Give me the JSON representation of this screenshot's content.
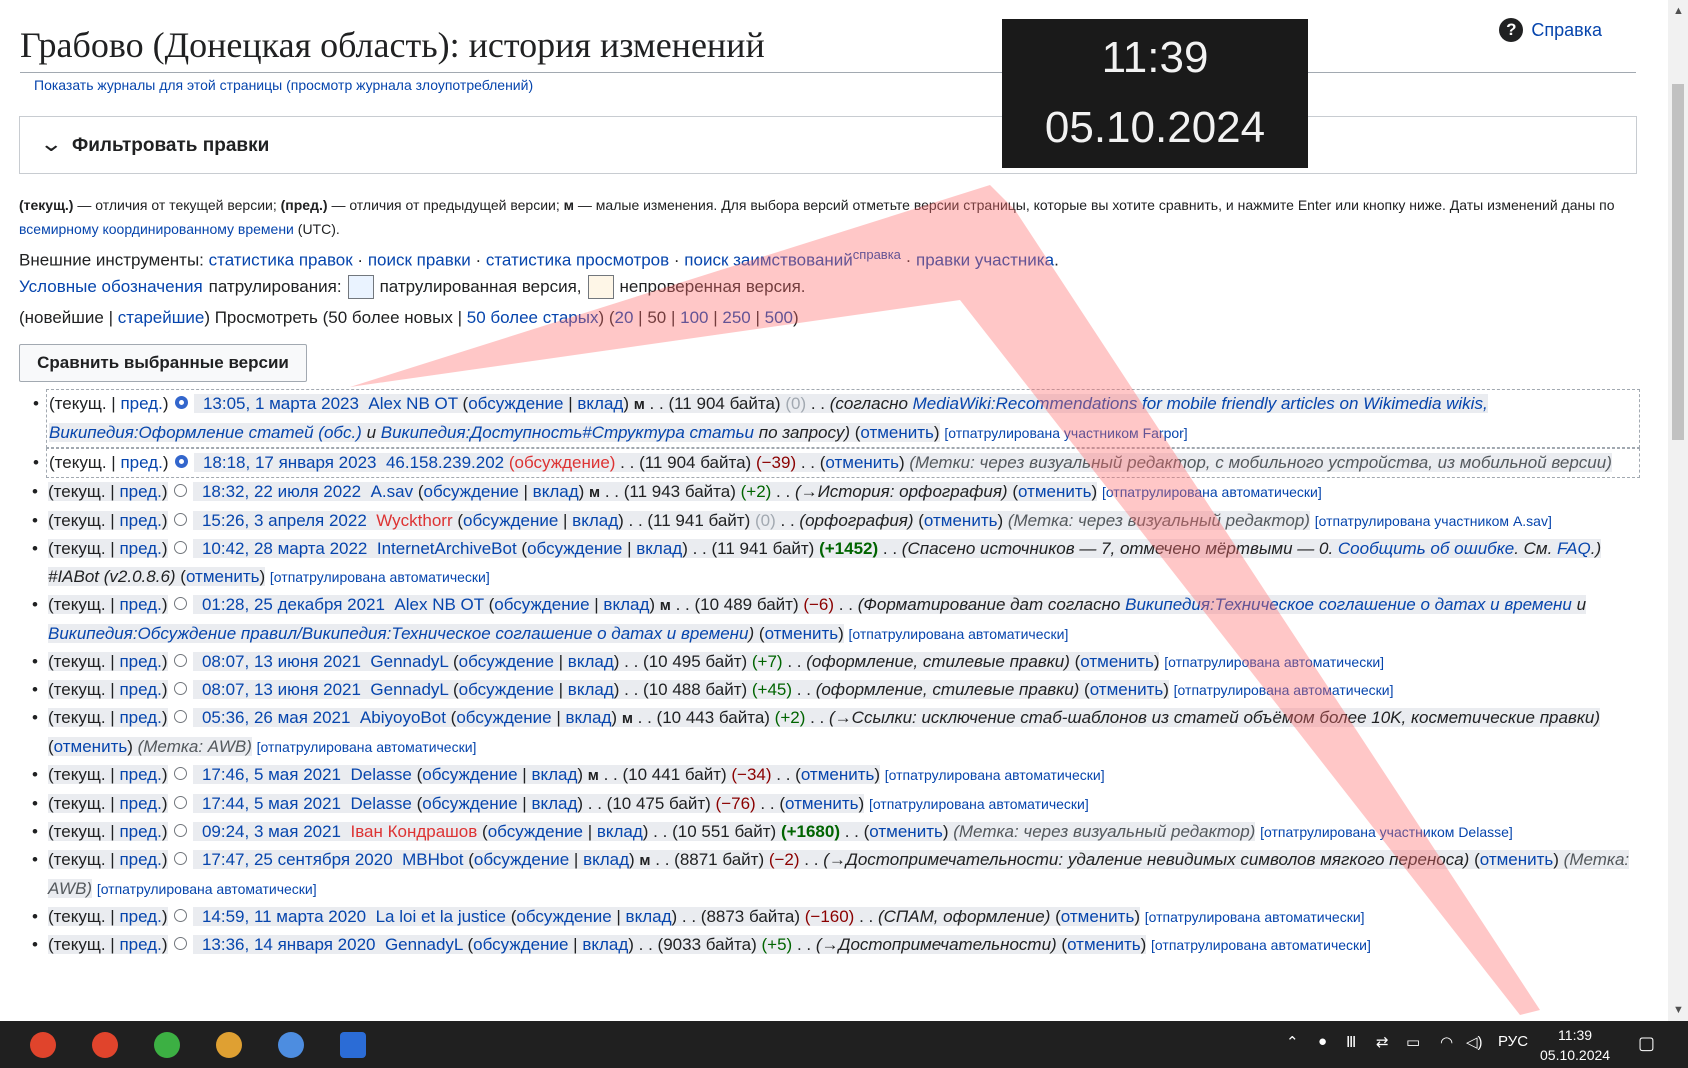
{
  "page": {
    "title": "Грабово (Донецкая область): история изменений",
    "help": "Справка",
    "logs_link": "Показать журналы для этой страницы",
    "abuse_link": "(просмотр журнала злоупотреблений)",
    "filter_label": "Фильтровать правки",
    "legend_line1": "— отличия от текущей версии;",
    "legend_cur": "(текущ.)",
    "legend_prev": "(пред.)",
    "legend_prev_text": "— отличия от предыдущей версии;",
    "legend_m": "м",
    "legend_m_text": "— малые изменения. Для выбора версий отметьте версии страницы, которые вы хотите сравнить, и нажмите Enter или кнопку ниже. Даты изменений даны по",
    "legend_utc_link": "всемирному координированному времени",
    "legend_utc": "(UTC).",
    "ext_label": "Внешние инструменты:",
    "ext_tools": [
      "статистика правок",
      "поиск правки",
      "статистика просмотров",
      "поиск заимствований"
    ],
    "ext_help": "справка",
    "ext_user": "правки участника",
    "patrol_link": "Условные обозначения",
    "patrol_label": "патрулирования:",
    "patrol_done": "патрулированная версия,",
    "patrol_not": "непроверенная версия.",
    "nav_newest": "(новейшие |",
    "nav_oldest": "старейшие",
    "nav_view": ") Просмотреть (50 более новых |",
    "nav_older": "50 более старых",
    "nav_counts": [
      "20",
      "50",
      "100",
      "250",
      "500"
    ],
    "compare_button": "Сравнить выбранные версии"
  },
  "history": [
    {
      "time": "13:05, 1 марта 2023",
      "user": "Alex NB OT",
      "minor": true,
      "size": "(11 904 байта)",
      "diff": "(0)",
      "diff_class": "neu",
      "comment_html": "(согласно <a>MediaWiki:Recommendations for mobile friendly articles on Wikimedia wikis, Википедия:Оформление статей (обс.)</a> и <a>Википедия:Доступность#Структура статьи</a> по запросу)",
      "tail": "[отпатрулирована участником Farpor]",
      "selected": true,
      "current": true
    },
    {
      "time": "18:18, 17 января 2023",
      "user": "46.158.239.202",
      "minor": false,
      "size": "(11 904 байта)",
      "diff": "(−39)",
      "diff_class": "neg",
      "comment_html": "",
      "tag": "(Метки: через визуальный редактор, с мобильного устройства, из мобильной версии)",
      "selected": true,
      "current": true,
      "anon": true
    },
    {
      "time": "18:32, 22 июля 2022",
      "user": "A.sav",
      "minor": true,
      "size": "(11 943 байта)",
      "diff": "(+2)",
      "diff_class": "pos",
      "comment_html": "(→История: орфография)",
      "tail": "[отпатрулирована автоматически]"
    },
    {
      "time": "15:26, 3 апреля 2022",
      "user": "Wyckthorr",
      "minor": false,
      "size": "(11 941 байт)",
      "diff": "(0)",
      "diff_class": "neu",
      "comment_html": "(орфография)",
      "tag": "(Метка: через визуальный редактор)",
      "tail": "[отпатрулирована участником A.sav]",
      "redUser": true
    },
    {
      "time": "10:42, 28 марта 2022",
      "user": "InternetArchiveBot",
      "minor": false,
      "size": "(11 941 байт)",
      "diff": "(+1452)",
      "diff_class": "posb",
      "comment_html": "(Спасено источников — 7, отмечено мёртвыми — 0. <a>Сообщить об ошибке</a>. См. <a>FAQ</a>.) #IABot (v2.0.8.6)",
      "tail": "[отпатрулирована автоматически]"
    },
    {
      "time": "01:28, 25 декабря 2021",
      "user": "Alex NB OT",
      "minor": true,
      "size": "(10 489 байт)",
      "diff": "(−6)",
      "diff_class": "neg",
      "comment_html": "(Форматирование дат согласно <a>Википедия:Техническое соглашение о датах и времени</a> и <a>Википедия:Обсуждение правил/Википедия:Техническое соглашение о датах и времени</a>)",
      "tail": "[отпатрулирована автоматически]"
    },
    {
      "time": "08:07, 13 июня 2021",
      "user": "GennadyL",
      "minor": false,
      "size": "(10 495 байт)",
      "diff": "(+7)",
      "diff_class": "pos",
      "comment_html": "(оформление, стилевые правки)",
      "tail": "[отпатрулирована автоматически]"
    },
    {
      "time": "08:07, 13 июня 2021",
      "user": "GennadyL",
      "minor": false,
      "size": "(10 488 байт)",
      "diff": "(+45)",
      "diff_class": "pos",
      "comment_html": "(оформление, стилевые правки)",
      "tail": "[отпатрулирована автоматически]"
    },
    {
      "time": "05:36, 26 мая 2021",
      "user": "AbiyoyoBot",
      "minor": true,
      "size": "(10 443 байта)",
      "diff": "(+2)",
      "diff_class": "pos",
      "comment_html": "(→Ссылки: исключение стаб-шаблонов из статей объёмом более 10K, косметические правки)",
      "tag": "(Метка: AWB)",
      "tail": "[отпатрулирована автоматически]"
    },
    {
      "time": "17:46, 5 мая 2021",
      "user": "Delasse",
      "minor": true,
      "size": "(10 441 байт)",
      "diff": "(−34)",
      "diff_class": "neg",
      "comment_html": "",
      "tail": "[отпатрулирована автоматически]"
    },
    {
      "time": "17:44, 5 мая 2021",
      "user": "Delasse",
      "minor": false,
      "size": "(10 475 байт)",
      "diff": "(−76)",
      "diff_class": "neg",
      "comment_html": "",
      "tail": "[отпатрулирована автоматически]"
    },
    {
      "time": "09:24, 3 мая 2021",
      "user": "Іван Кондрашов",
      "minor": false,
      "size": "(10 551 байт)",
      "diff": "(+1680)",
      "diff_class": "posb",
      "comment_html": "",
      "tag": "(Метка: через визуальный редактор)",
      "tail": "[отпатрулирована участником Delasse]",
      "redUser": true
    },
    {
      "time": "17:47, 25 сентября 2020",
      "user": "MBHbot",
      "minor": true,
      "size": "(8871 байт)",
      "diff": "(−2)",
      "diff_class": "neg",
      "comment_html": "(→Достопримечательности: удаление невидимых символов мягкого переноса)",
      "tag": "(Метка: AWB)",
      "tail": "[отпатрулирована автоматически]"
    },
    {
      "time": "14:59, 11 марта 2020",
      "user": "La loi et la justice",
      "minor": false,
      "size": "(8873 байта)",
      "diff": "(−160)",
      "diff_class": "neg",
      "comment_html": "(СПАМ, оформление)",
      "tail": "[отпатрулирована автоматически]"
    },
    {
      "time": "13:36, 14 января 2020",
      "user": "GennadyL",
      "minor": false,
      "size": "(9033 байта)",
      "diff": "(+5)",
      "diff_class": "pos",
      "comment_html": "(→Достопримечательности)",
      "tail": "[отпатрулирована автоматически]"
    }
  ],
  "labels": {
    "cur": "текущ.",
    "prev": "пред.",
    "talk": "обсуждение",
    "contrib": "вклад",
    "undo": "отменить",
    "minor": "м"
  },
  "overlay_clock": {
    "time": "11:39",
    "date": "05.10.2024"
  },
  "taskbar": {
    "lang": "РУС",
    "time": "11:39",
    "date": "05.10.2024"
  }
}
